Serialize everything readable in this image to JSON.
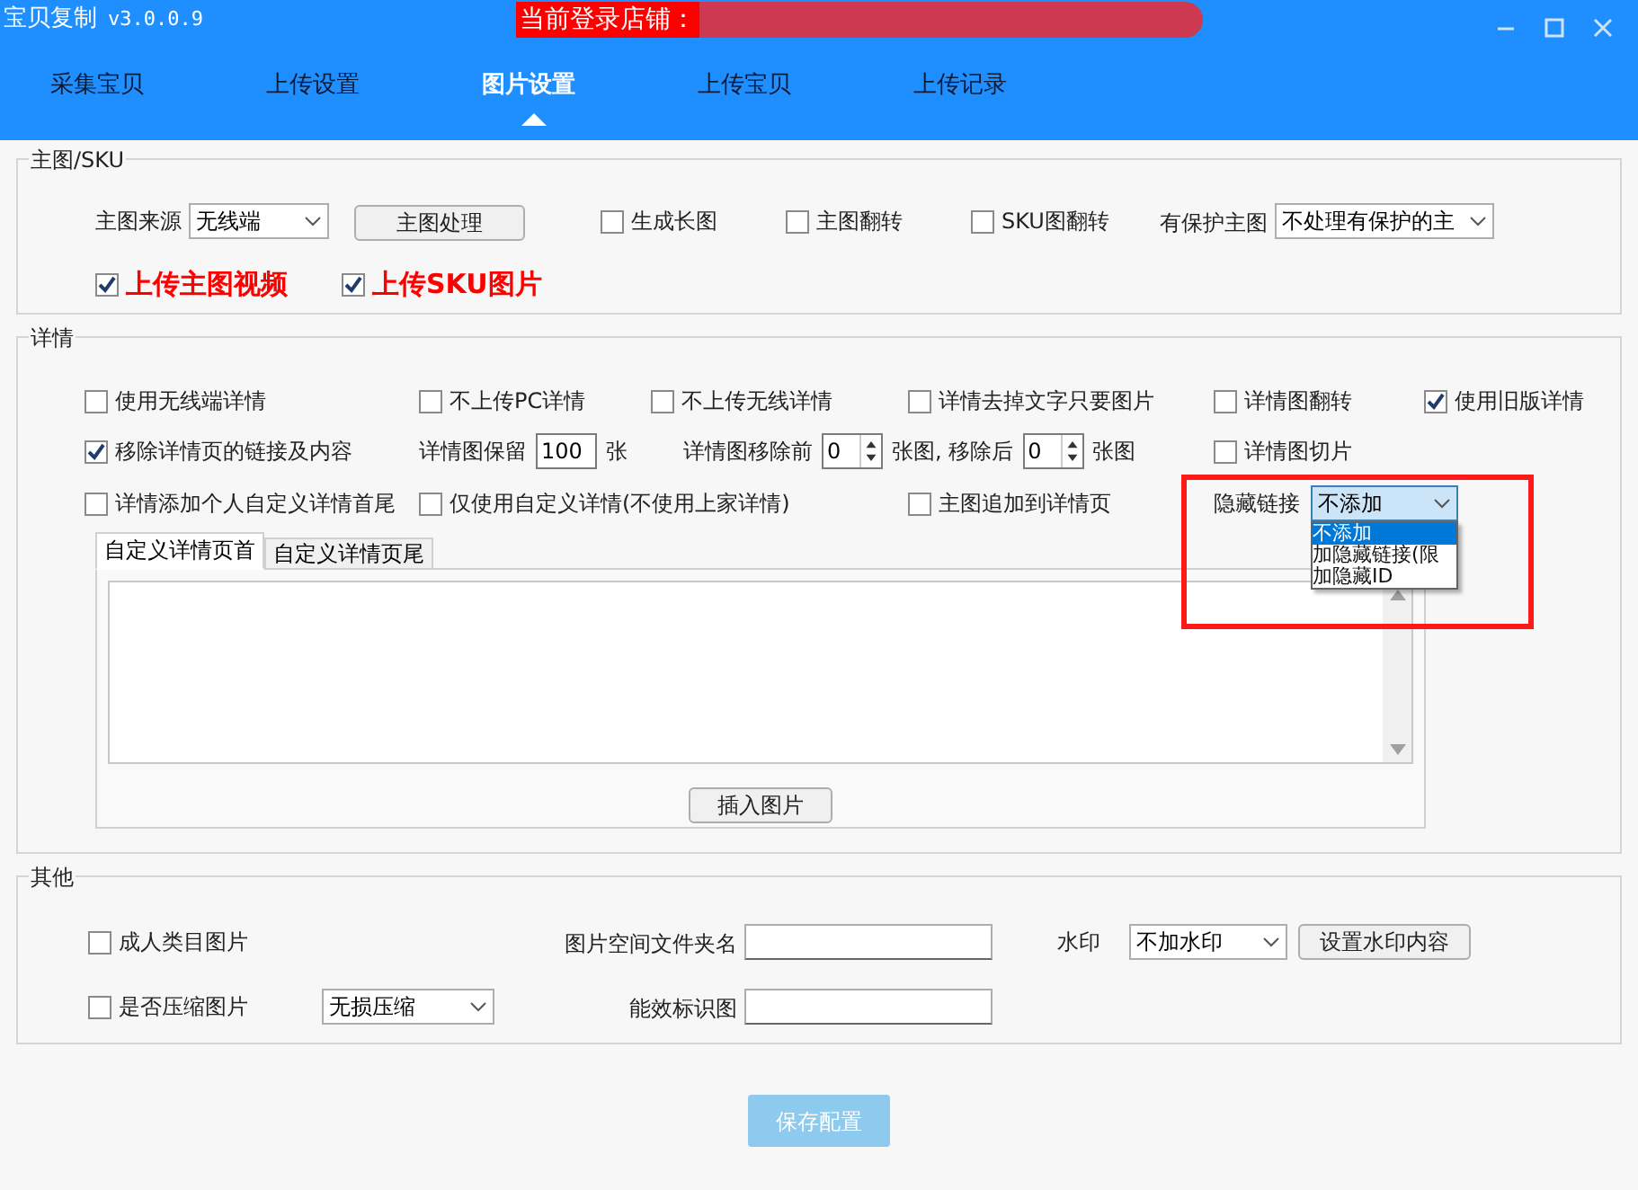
{
  "window": {
    "title": "宝贝复制",
    "version": "v3.0.0.9",
    "login_label": "当前登录店铺："
  },
  "tabs": [
    {
      "label": "采集宝贝",
      "selected": false
    },
    {
      "label": "上传设置",
      "selected": false
    },
    {
      "label": "图片设置",
      "selected": true
    },
    {
      "label": "上传宝贝",
      "selected": false
    },
    {
      "label": "上传记录",
      "selected": false
    }
  ],
  "main_sku": {
    "legend": "主图/SKU",
    "source": {
      "label": "主图来源",
      "value": "无线端"
    },
    "process_button": "主图处理",
    "checks": [
      {
        "label": "生成长图",
        "checked": false
      },
      {
        "label": "主图翻转",
        "checked": false
      },
      {
        "label": "SKU图翻转",
        "checked": false
      }
    ],
    "protect": {
      "label": "有保护主图",
      "value": "不处理有保护的主"
    },
    "upload_checks": [
      {
        "label": "上传主图视频",
        "checked": true
      },
      {
        "label": "上传SKU图片",
        "checked": true
      }
    ]
  },
  "detail": {
    "legend": "详情",
    "row1": [
      {
        "label": "使用无线端详情",
        "checked": false
      },
      {
        "label": "不上传PC详情",
        "checked": false
      },
      {
        "label": "不上传无线详情",
        "checked": false
      },
      {
        "label": "详情去掉文字只要图片",
        "checked": false
      },
      {
        "label": "详情图翻转",
        "checked": false
      },
      {
        "label": "使用旧版详情",
        "checked": true
      }
    ],
    "remove_links": {
      "label": "移除详情页的链接及内容",
      "checked": true
    },
    "keep": {
      "label": "详情图保留",
      "value": "100",
      "unit": "张"
    },
    "remove": {
      "label": "详情图移除前",
      "before": "0",
      "middle": "张图, 移除后",
      "after": "0",
      "unit": "张图"
    },
    "slice": {
      "label": "详情图切片",
      "checked": false
    },
    "custom_head": {
      "label": "详情添加个人自定义详情首尾",
      "checked": false
    },
    "custom_only": {
      "label": "仅使用自定义详情(不使用上家详情)",
      "checked": false
    },
    "append_main": {
      "label": "主图追加到详情页",
      "checked": false
    },
    "hidden_link": {
      "label": "隐藏链接",
      "value": "不添加",
      "highlighted": true,
      "options": [
        {
          "label": "不添加",
          "selected": true
        },
        {
          "label": "加隐藏链接(限",
          "selected": false
        },
        {
          "label": "加隐藏ID",
          "selected": false
        }
      ]
    },
    "editor_tabs": [
      {
        "label": "自定义详情页首",
        "selected": true
      },
      {
        "label": "自定义详情页尾",
        "selected": false
      }
    ],
    "insert_button": "插入图片"
  },
  "other": {
    "legend": "其他",
    "adult": {
      "label": "成人类目图片",
      "checked": false
    },
    "compress": {
      "label": "是否压缩图片",
      "checked": false,
      "value": "无损压缩"
    },
    "folder": {
      "label": "图片空间文件夹名"
    },
    "efficacy": {
      "label": "能效标识图"
    },
    "watermark": {
      "label": "水印",
      "value": "不加水印",
      "button": "设置水印内容"
    }
  },
  "save_button": "保存配置"
}
